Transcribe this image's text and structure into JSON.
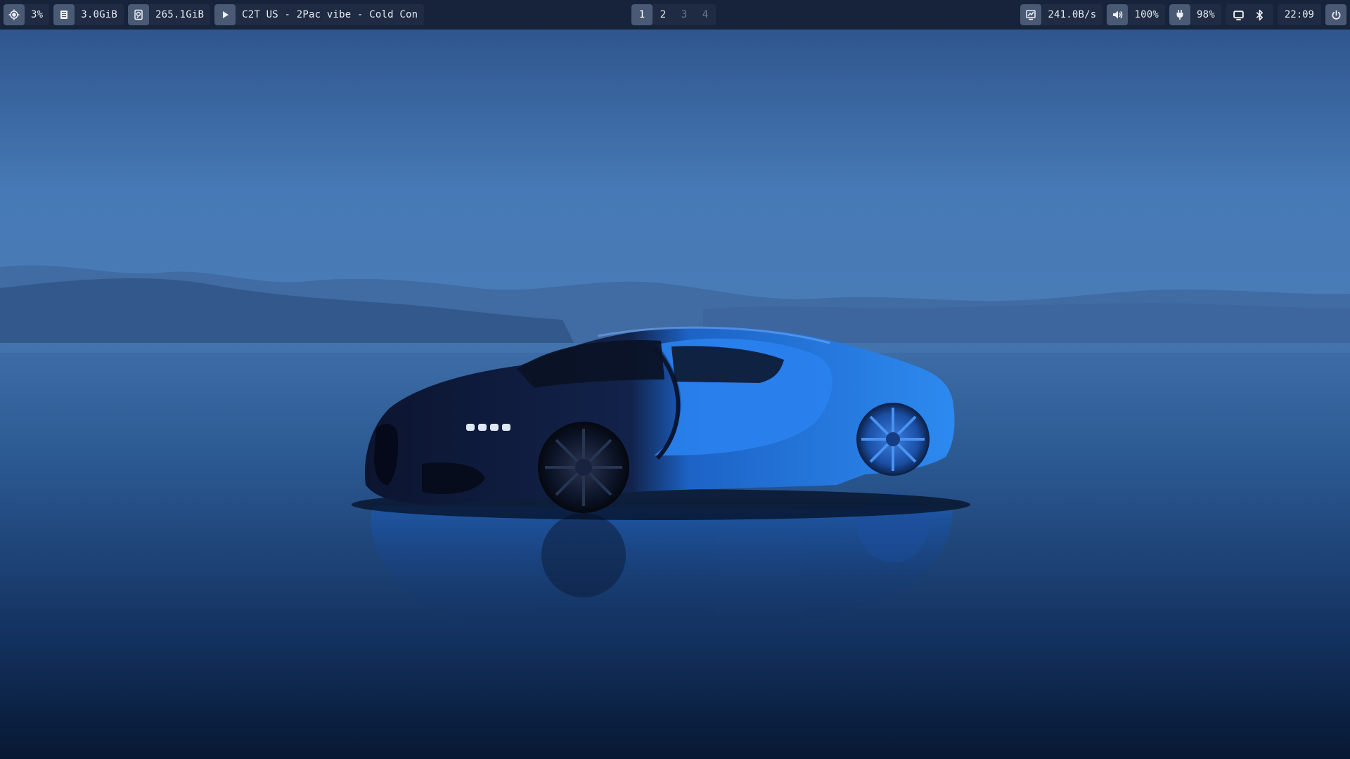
{
  "wallpaper": {
    "subject": "blue-hypercar-on-reflective-salt-flat",
    "sky_color": "#4677b3",
    "ground_color": "#0d264a",
    "car_body_color": "#1f7ae0",
    "car_front_color": "#0f1a36"
  },
  "bar": {
    "background": "#17233a",
    "accent": "#4a5a74",
    "modules_left": {
      "cpu": {
        "icon": "cpu-icon",
        "value": "3%"
      },
      "memory": {
        "icon": "memory-icon",
        "value": "3.0GiB"
      },
      "disk": {
        "icon": "disk-icon",
        "value": "265.1GiB"
      },
      "media": {
        "icon": "play-icon",
        "value": "C2T US - 2Pac vibe - Cold Con"
      }
    },
    "workspaces": {
      "items": [
        "1",
        "2",
        "3",
        "4"
      ],
      "active": "1",
      "occupied": [
        "1",
        "2"
      ]
    },
    "modules_right": {
      "network": {
        "icon": "network-icon",
        "value": "241.0B/s"
      },
      "volume": {
        "icon": "volume-icon",
        "value": "100%"
      },
      "battery": {
        "icon": "battery-plug-icon",
        "value": "98%"
      },
      "tray": {
        "icons": [
          "monitor-icon",
          "bluetooth-icon"
        ]
      },
      "clock": {
        "value": "22:09"
      },
      "power": {
        "icon": "power-icon"
      }
    }
  }
}
